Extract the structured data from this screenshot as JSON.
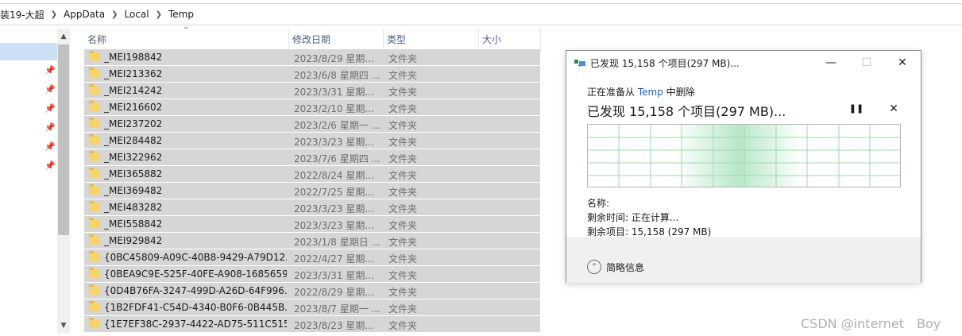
{
  "breadcrumb": {
    "segments": [
      "装19-大超",
      "AppData",
      "Local",
      "Temp"
    ]
  },
  "file_list": {
    "columns": [
      "名称",
      "修改日期",
      "类型",
      "大小"
    ],
    "rows": [
      {
        "name": "_MEI198842",
        "date": "2023/8/29 星期...",
        "type": "文件夹"
      },
      {
        "name": "_MEI213362",
        "date": "2023/6/8 星期四 ...",
        "type": "文件夹"
      },
      {
        "name": "_MEI214242",
        "date": "2023/3/31 星期...",
        "type": "文件夹"
      },
      {
        "name": "_MEI216602",
        "date": "2023/2/10 星期...",
        "type": "文件夹"
      },
      {
        "name": "_MEI237202",
        "date": "2023/2/6 星期一 ...",
        "type": "文件夹"
      },
      {
        "name": "_MEI284482",
        "date": "2023/3/23 星期...",
        "type": "文件夹"
      },
      {
        "name": "_MEI322962",
        "date": "2023/7/6 星期四 ...",
        "type": "文件夹"
      },
      {
        "name": "_MEI365882",
        "date": "2022/8/24 星期...",
        "type": "文件夹"
      },
      {
        "name": "_MEI369482",
        "date": "2022/7/25 星期...",
        "type": "文件夹"
      },
      {
        "name": "_MEI483282",
        "date": "2023/3/23 星期...",
        "type": "文件夹"
      },
      {
        "name": "_MEI558842",
        "date": "2023/3/23 星期...",
        "type": "文件夹"
      },
      {
        "name": "_MEI929842",
        "date": "2023/1/8 星期日 ...",
        "type": "文件夹"
      },
      {
        "name": "{0BC45809-A09C-40B8-9429-A79D12...",
        "date": "2022/4/27 星期...",
        "type": "文件夹"
      },
      {
        "name": "{0BEA9C9E-525F-40FE-A908-1685659...",
        "date": "2023/3/31 星期...",
        "type": "文件夹"
      },
      {
        "name": "{0D4B76FA-3247-499D-A26D-64F996...",
        "date": "2022/8/29 星期...",
        "type": "文件夹"
      },
      {
        "name": "{1B2FDF41-C54D-4340-B0F6-0B445B...",
        "date": "2023/8/7 星期一 ...",
        "type": "文件夹"
      },
      {
        "name": "{1E7EF38C-2937-4422-AD75-511C515...",
        "date": "2023/8/23 星期...",
        "type": "文件夹"
      }
    ]
  },
  "dialog": {
    "title": "已发现 15,158 个项目(297 MB)...",
    "prep_prefix": "正在准备从 ",
    "prep_location": "Temp",
    "prep_suffix": " 中删除",
    "headline": "已发现 15,158 个项目(297 MB)...",
    "name_label": "名称:",
    "time_remaining": "剩余时间: 正在计算...",
    "items_remaining": "剩余项目: 15,158 (297 MB)",
    "footer_label": "简略信息",
    "minimize_glyph": "—",
    "maximize_glyph": "☐",
    "close_glyph": "✕",
    "pause_glyph": "❚❚",
    "stop_glyph": "✕",
    "accent_color": "#1a5fb4",
    "graph_color": "#7fd49a"
  },
  "watermark": "CSDN @internet　Boy",
  "icons": [
    "folder-icon",
    "pin-icon",
    "recycle-delete-icon",
    "chevron-up-icon",
    "pause-icon",
    "stop-icon"
  ]
}
